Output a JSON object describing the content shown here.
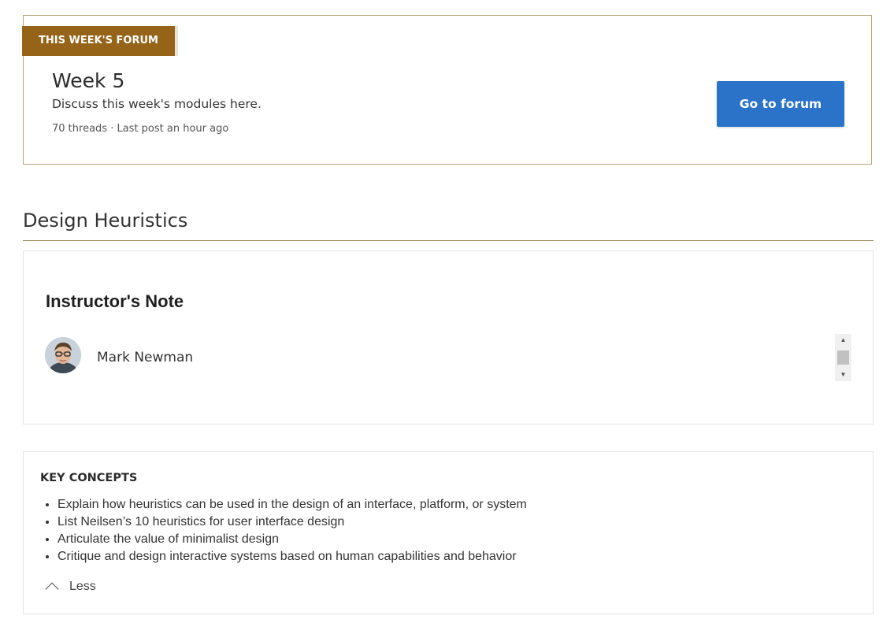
{
  "forum": {
    "badge": "THIS WEEK'S FORUM",
    "title": "Week 5",
    "description": "Discuss this week's modules here.",
    "meta": "70 threads · Last post an hour ago",
    "button_label": "Go to forum"
  },
  "section": {
    "title": "Design Heuristics"
  },
  "instructor_note": {
    "title": "Instructor's Note",
    "name": "Mark Newman",
    "avatar_icon": "avatar-photo-icon"
  },
  "key_concepts": {
    "title": "KEY CONCEPTS",
    "items": [
      "Explain how heuristics can be used in the design of an interface, platform, or system",
      "List Neilsen’s 10 heuristics for user interface design",
      "Articulate the value of minimalist design",
      "Critique and design interactive systems based on human capabilities and behavior"
    ],
    "toggle_label": "Less"
  },
  "colors": {
    "badge_bg": "#956418",
    "button_bg": "#2a73c9",
    "card_border": "#b8a47c"
  }
}
